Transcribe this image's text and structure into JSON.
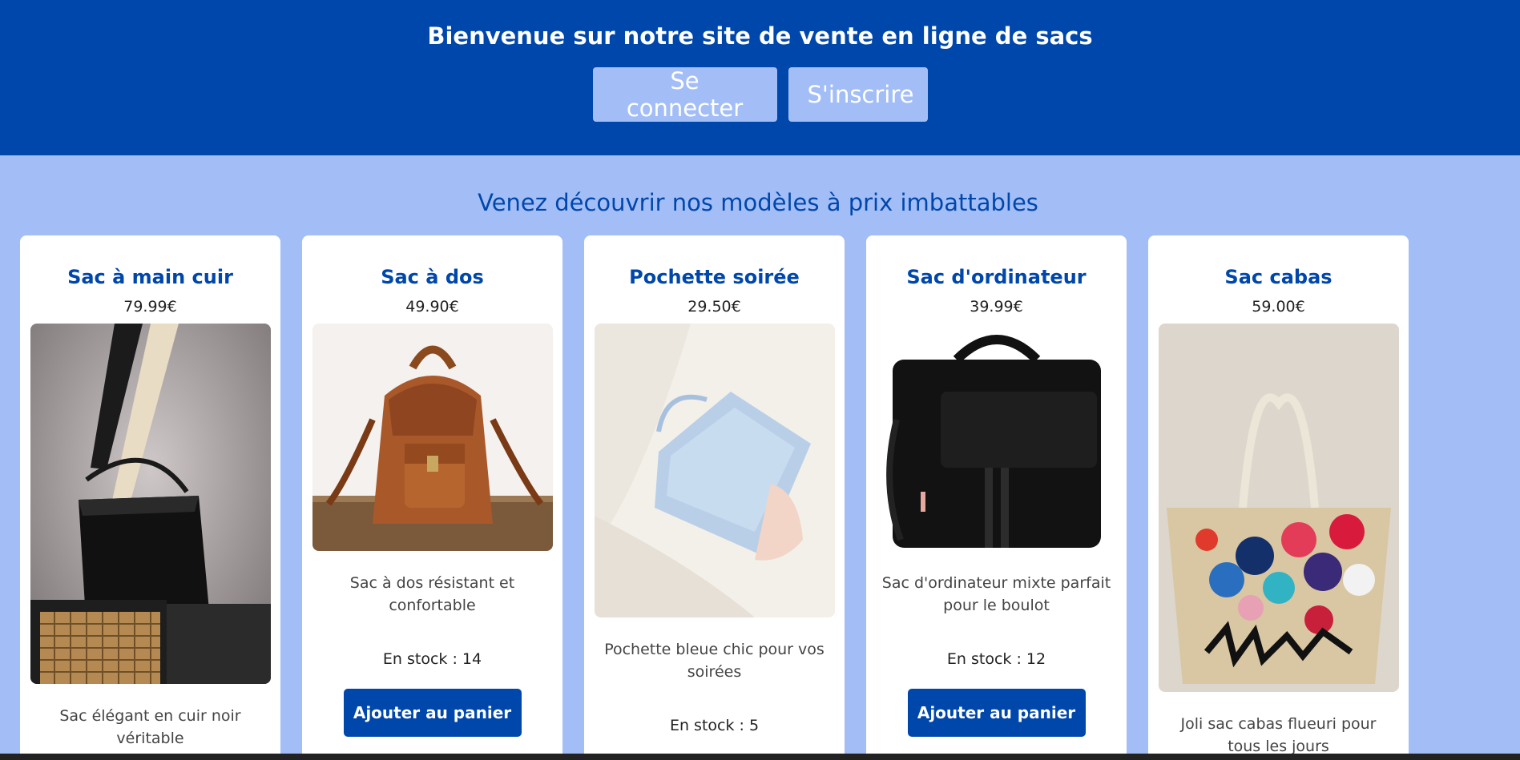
{
  "header": {
    "title": "Bienvenue sur notre site de vente en ligne de sacs",
    "login_label": "Se connecter",
    "signup_label": "S'inscrire"
  },
  "main": {
    "subtitle": "Venez découvrir nos modèles à prix imbattables"
  },
  "products": [
    {
      "name": "Sac à main cuir",
      "price": "79.99€",
      "description": "Sac élégant en cuir noir véritable",
      "stock": "",
      "button": ""
    },
    {
      "name": "Sac à dos",
      "price": "49.90€",
      "description": "Sac à dos résistant et confortable",
      "stock": "En stock : 14",
      "button": "Ajouter au panier"
    },
    {
      "name": "Pochette soirée",
      "price": "29.50€",
      "description": "Pochette bleue chic pour vos soirées",
      "stock": "En stock : 5",
      "button": ""
    },
    {
      "name": "Sac d'ordinateur",
      "price": "39.99€",
      "description": "Sac d'ordinateur mixte parfait pour le boulot",
      "stock": "En stock : 12",
      "button": "Ajouter au panier"
    },
    {
      "name": "Sac cabas",
      "price": "59.00€",
      "description": "Joli sac cabas flueuri pour tous les jours",
      "stock": "",
      "button": ""
    }
  ],
  "colors": {
    "primary": "#0047ab",
    "background": "#a3bef7",
    "card": "#ffffff"
  }
}
